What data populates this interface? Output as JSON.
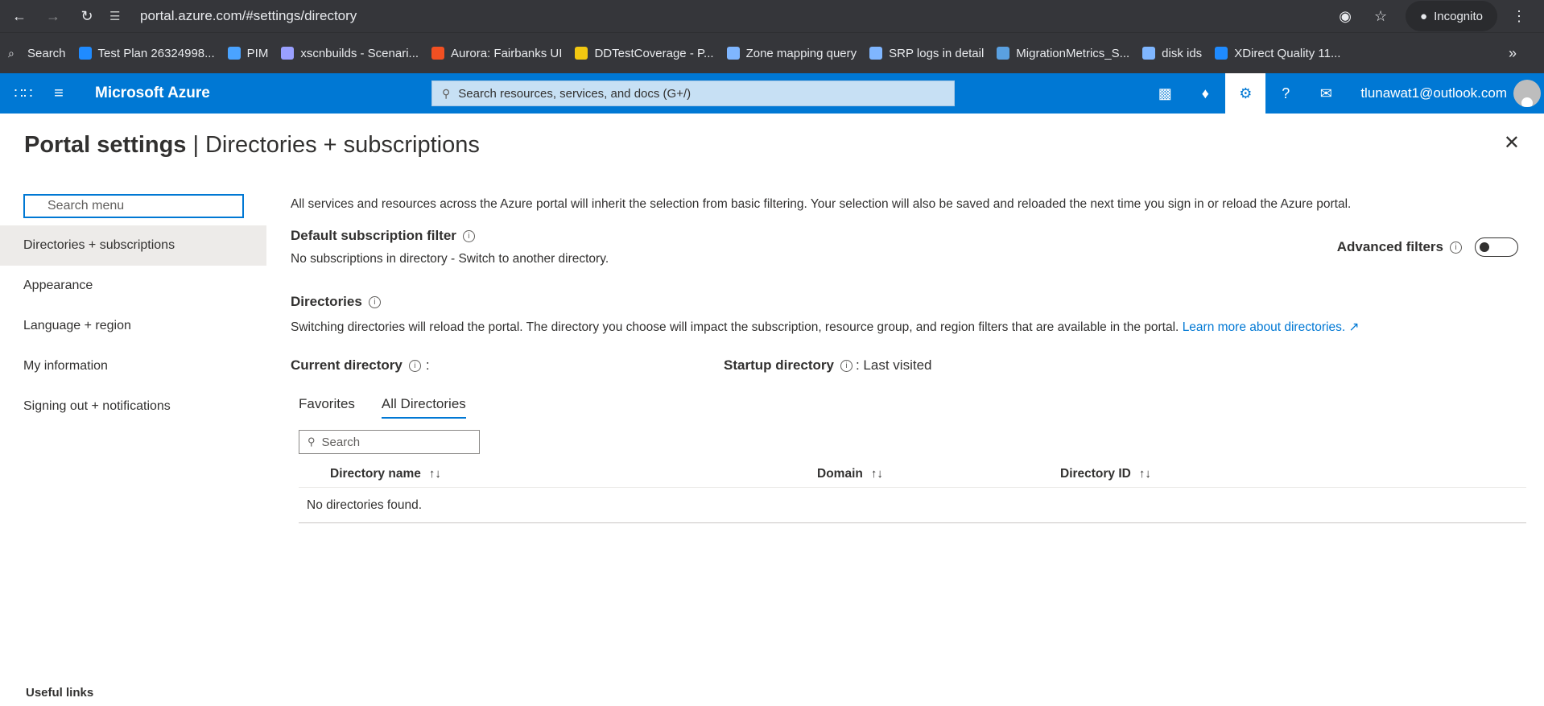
{
  "browser": {
    "url": "portal.azure.com/#settings/directory",
    "incognito_label": "Incognito",
    "bookmarks": [
      {
        "label": "Search",
        "icon": "search-icon",
        "color": "#35363a"
      },
      {
        "label": "Test Plan 26324998...",
        "icon": "azure-devops-icon",
        "color": "#1f8bff"
      },
      {
        "label": "PIM",
        "icon": "pim-icon",
        "color": "#4aa3ff"
      },
      {
        "label": "xscnbuilds - Scenari...",
        "icon": "x-icon",
        "color": "#9aa0ff"
      },
      {
        "label": "Aurora: Fairbanks UI",
        "icon": "microsoft-icon",
        "color": "#f25022"
      },
      {
        "label": "DDTestCoverage - P...",
        "icon": "powerbi-icon",
        "color": "#f2c811"
      },
      {
        "label": "Zone mapping query",
        "icon": "kusto-icon",
        "color": "#7fb6ff"
      },
      {
        "label": "SRP logs in detail",
        "icon": "kusto-icon",
        "color": "#7fb6ff"
      },
      {
        "label": "MigrationMetrics_S...",
        "icon": "globe-icon",
        "color": "#5aa0e0"
      },
      {
        "label": "disk ids",
        "icon": "kusto-icon",
        "color": "#7fb6ff"
      },
      {
        "label": "XDirect Quality 11...",
        "icon": "azure-devops-icon",
        "color": "#1f8bff"
      }
    ],
    "more": "»"
  },
  "azure": {
    "brand": "Microsoft Azure",
    "search_placeholder": "Search resources, services, and docs (G+/)",
    "user": "tlunawat1@outlook.com"
  },
  "page": {
    "title_bold": "Portal settings",
    "title_sep": "|",
    "title_rest": "Directories + subscriptions"
  },
  "leftnav": {
    "search_placeholder": "Search menu",
    "items": [
      "Directories + subscriptions",
      "Appearance",
      "Language + region",
      "My information",
      "Signing out + notifications"
    ],
    "useful_links": "Useful links"
  },
  "main": {
    "intro": "All services and resources across the Azure portal will inherit the selection from basic filtering. Your selection will also be saved and reloaded the next time you sign in or reload the Azure portal.",
    "default_filter_title": "Default subscription filter",
    "default_filter_text": "No subscriptions in directory - Switch to another directory.",
    "advanced_filters": "Advanced filters",
    "directories_title": "Directories",
    "directories_desc": "Switching directories will reload the portal. The directory you choose will impact the subscription, resource group, and region filters that are available in the portal.",
    "learn_more": "Learn more about directories.",
    "current_directory": "Current directory",
    "current_colon": ":",
    "startup_directory": "Startup directory",
    "startup_value": ": Last visited",
    "tabs": [
      "Favorites",
      "All Directories"
    ],
    "table_search_placeholder": "Search",
    "columns": [
      "Directory name",
      "Domain",
      "Directory ID"
    ],
    "empty": "No directories found."
  }
}
